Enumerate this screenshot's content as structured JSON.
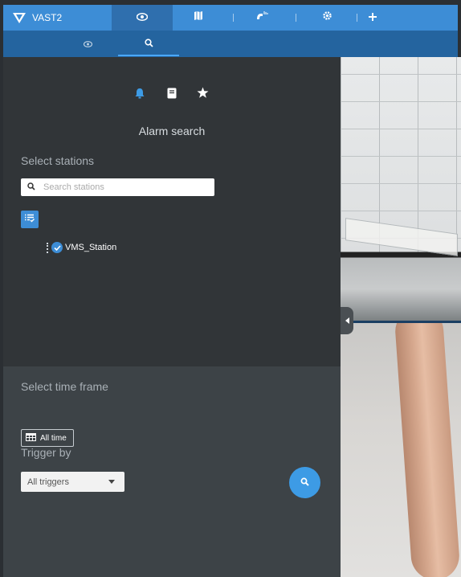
{
  "app": {
    "name": "VAST2"
  },
  "top_tabs": [
    {
      "id": "liveview",
      "icon": "eye-icon",
      "active": true
    },
    {
      "id": "map",
      "icon": "map-icon",
      "active": false
    },
    {
      "id": "alarm",
      "icon": "magnet-alarm-icon",
      "active": false
    },
    {
      "id": "settings",
      "icon": "gear-icon",
      "active": false
    },
    {
      "id": "add",
      "icon": "plus-icon",
      "active": false
    }
  ],
  "sub_tabs": [
    {
      "id": "view",
      "icon": "eye-icon",
      "active": false
    },
    {
      "id": "search",
      "icon": "search-icon",
      "active": true
    }
  ],
  "search_modes": [
    {
      "id": "alarm",
      "icon": "bell-icon",
      "active": true
    },
    {
      "id": "bookmark",
      "icon": "document-icon",
      "active": false
    },
    {
      "id": "favorite",
      "icon": "star-icon",
      "active": false
    }
  ],
  "panel": {
    "title": "Alarm search",
    "select_stations_label": "Select stations",
    "search_placeholder": "Search stations",
    "stations": [
      {
        "name": "VMS_Station",
        "checked": true
      }
    ],
    "select_time_frame_label": "Select time frame",
    "time_frame_button": "All time",
    "trigger_by_label": "Trigger by",
    "trigger_select_value": "All triggers"
  },
  "colors": {
    "accent": "#3d8dd6",
    "topbar": "#3d8dd6",
    "subbar": "#24649f",
    "panel_dark": "#313538",
    "panel_mid": "#3d4347"
  }
}
